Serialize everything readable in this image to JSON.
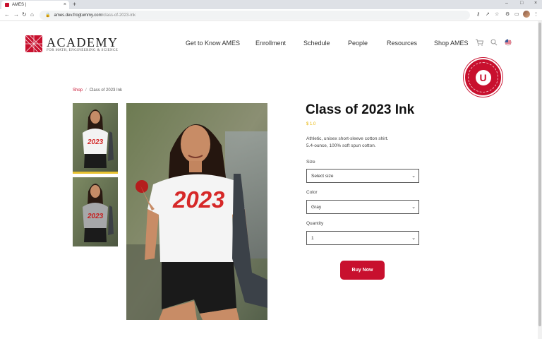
{
  "browser": {
    "tab_title": "AMES |",
    "tab_close": "×",
    "new_tab": "+",
    "url_host": "ames.dev.frogtummy.com",
    "url_path": "/class-of-2023-ink",
    "window_controls": [
      "–",
      "□",
      "×"
    ]
  },
  "site": {
    "logo_title": "ACADEMY",
    "logo_subtitle": "for Math, Engineering & Science",
    "nav": [
      "Get to Know AMES",
      "Enrollment",
      "Schedule",
      "People",
      "Resources",
      "Shop AMES"
    ],
    "badge_letter": "U",
    "brand_color": "#c8102e"
  },
  "breadcrumb": {
    "shop": "Shop",
    "separator": "/",
    "current": "Class of 2023 Ink"
  },
  "gallery": {
    "shirt_print": "2023",
    "thumbnail_count": 2,
    "active_thumbnail": 1
  },
  "product": {
    "title": "Class of 2023 Ink",
    "price": "$ 1.0",
    "description_line1": "Athletic, unisex short-sleeve cotton shirt.",
    "description_line2": "5.4-ounce, 100% soft spun cotton.",
    "size_label": "Size",
    "size_value": "Select size",
    "color_label": "Color",
    "color_value": "Gray",
    "quantity_label": "Quantity",
    "quantity_value": "1",
    "buy_label": "Buy Now"
  }
}
